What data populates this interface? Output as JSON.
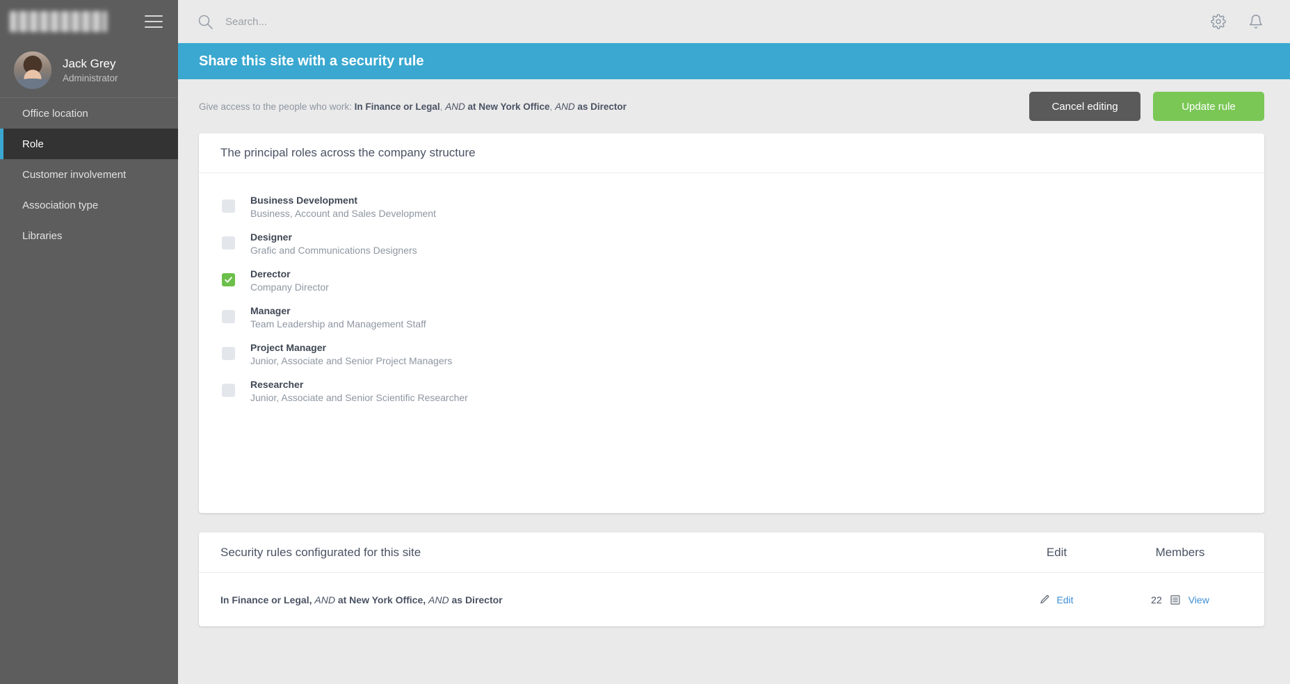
{
  "sidebar": {
    "logo": "blurred-company-logo",
    "menu_icon": "hamburger-menu-icon",
    "profile": {
      "name": "Jack Grey",
      "role": "Administrator"
    },
    "items": [
      {
        "label": "Office location",
        "active": false
      },
      {
        "label": "Role",
        "active": true
      },
      {
        "label": "Customer involvement",
        "active": false
      },
      {
        "label": "Association type",
        "active": false
      },
      {
        "label": "Libraries",
        "active": false
      }
    ]
  },
  "topbar": {
    "search_placeholder": "Search...",
    "search_value": "",
    "icons": [
      "gear-icon",
      "bell-icon"
    ]
  },
  "banner": {
    "title": "Share this site with a security rule",
    "color": "#3aa8d0"
  },
  "rulebar": {
    "prefix": "Give access to the people who work:",
    "segments": [
      {
        "text": "In Finance or Legal",
        "style": "bold"
      },
      {
        "text": ",",
        "style": "plain"
      },
      {
        "text": "AND",
        "style": "italic"
      },
      {
        "text": "at New York Office",
        "style": "bold"
      },
      {
        "text": ",",
        "style": "plain"
      },
      {
        "text": "AND",
        "style": "italic"
      },
      {
        "text": "as Director",
        "style": "bold"
      }
    ],
    "full_text": "In Finance or Legal, AND at New York Office, AND as Director",
    "cancel_label": "Cancel editing",
    "update_label": "Update rule",
    "cancel_color": "#5a5a5a",
    "update_color": "#7ac756"
  },
  "roles_card": {
    "title": "The principal roles across the company structure",
    "items": [
      {
        "name": "Business Development",
        "desc": "Business, Account and Sales Development",
        "checked": false
      },
      {
        "name": "Designer",
        "desc": "Grafic and Communications Designers",
        "checked": false
      },
      {
        "name": "Derector",
        "desc": "Company Director",
        "checked": true
      },
      {
        "name": "Manager",
        "desc": "Team Leadership and Management Staff",
        "checked": false
      },
      {
        "name": "Project Manager",
        "desc": "Junior, Associate and Senior Project Managers",
        "checked": false
      },
      {
        "name": "Researcher",
        "desc": "Junior, Associate and Senior Scientific Researcher",
        "checked": false
      }
    ]
  },
  "rules_card": {
    "columns": {
      "description": "Security rules configurated for this site",
      "edit": "Edit",
      "members": "Members"
    },
    "rows": [
      {
        "description_parts": [
          {
            "text": "In Finance or Legal",
            "style": "bold"
          },
          {
            "text": ",",
            "style": "plain"
          },
          {
            "text": "AND",
            "style": "italic"
          },
          {
            "text": "at New York Office",
            "style": "bold"
          },
          {
            "text": ",",
            "style": "plain"
          },
          {
            "text": "AND",
            "style": "italic"
          },
          {
            "text": "as Director",
            "style": "bold"
          }
        ],
        "description": "In Finance or Legal, AND at New York Office, AND as Director",
        "edit_label": "Edit",
        "member_count": "22",
        "view_label": "View"
      }
    ]
  }
}
